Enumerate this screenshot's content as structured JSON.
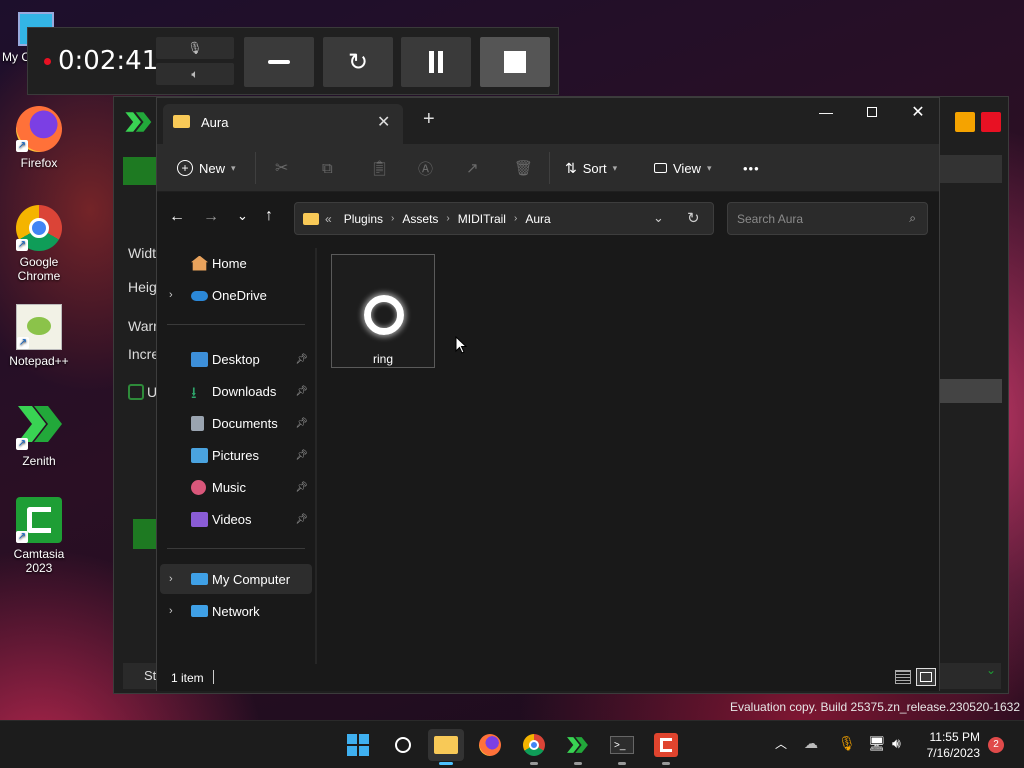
{
  "desktop": {
    "icons": [
      {
        "label": "My C"
      },
      {
        "label": "Firefox"
      },
      {
        "label": "Google Chrome"
      },
      {
        "label": "Notepad++"
      },
      {
        "label": "Zenith"
      },
      {
        "label": "Camtasia 2023"
      }
    ],
    "watermark": "Evaluation copy. Build 25375.zn_release.230520-1632"
  },
  "recorder": {
    "elapsed": "0:02:41",
    "mic_icon": "microphone-icon",
    "speaker_icon": "speaker-icon"
  },
  "zenith_window": {
    "labels": [
      "Widt",
      "Heig",
      "Warr",
      "Incre",
      "U",
      "St"
    ],
    "accent": "#1e7a22"
  },
  "explorer": {
    "tab_title": "Aura",
    "toolbar": {
      "new": "New",
      "sort": "Sort",
      "view": "View",
      "more": "•••"
    },
    "breadcrumb": [
      "Plugins",
      "Assets",
      "MIDITrail",
      "Aura"
    ],
    "breadcrumb_overflow": "«",
    "search_placeholder": "Search Aura",
    "sidebar": {
      "home": "Home",
      "onedrive": "OneDrive",
      "desktop": "Desktop",
      "downloads": "Downloads",
      "documents": "Documents",
      "pictures": "Pictures",
      "music": "Music",
      "videos": "Videos",
      "my_computer": "My Computer",
      "network": "Network"
    },
    "files": [
      {
        "name": "ring"
      }
    ],
    "status": "1 item"
  },
  "taskbar": {
    "time": "11:55 PM",
    "date": "7/16/2023",
    "notifications": "2"
  }
}
